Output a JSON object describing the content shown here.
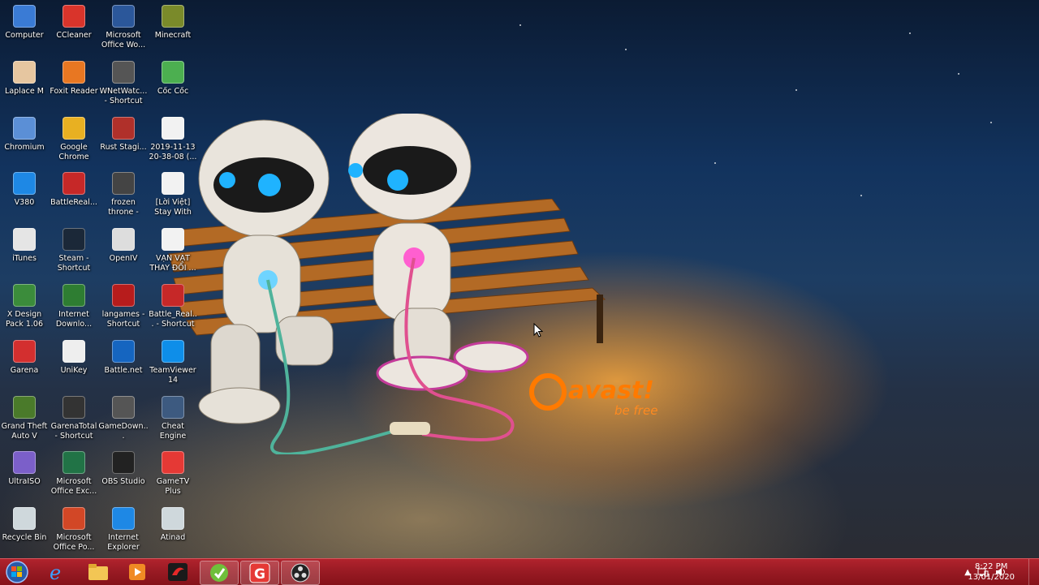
{
  "desktop_icons": [
    {
      "label": "Computer",
      "icon": "computer-icon",
      "color": "#3a7bd5"
    },
    {
      "label": "CCleaner",
      "icon": "ccleaner-icon",
      "color": "#d9342b"
    },
    {
      "label": "Microsoft Office Wo...",
      "icon": "word-icon",
      "color": "#2b579a"
    },
    {
      "label": "Minecraft",
      "icon": "minecraft-icon",
      "color": "#7a8a2a"
    },
    {
      "label": "Laplace M",
      "icon": "laplace-icon",
      "color": "#e6c6a0"
    },
    {
      "label": "Foxit Reader",
      "icon": "foxit-icon",
      "color": "#e87722"
    },
    {
      "label": "WNetWatc... - Shortcut",
      "icon": "wnetwatcher-icon",
      "color": "#555555"
    },
    {
      "label": "Cốc Cốc",
      "icon": "coccoc-icon",
      "color": "#4caf50"
    },
    {
      "label": "Chromium",
      "icon": "chromium-icon",
      "color": "#5b8fd6"
    },
    {
      "label": "Google Chrome",
      "icon": "chrome-icon",
      "color": "#e8b022"
    },
    {
      "label": "Rust Stagi...",
      "icon": "rust-icon",
      "color": "#b0302a"
    },
    {
      "label": "2019-11-13 20-38-08 (...",
      "icon": "audio-file-icon",
      "color": "#f2f2f2"
    },
    {
      "label": "V380",
      "icon": "v380-icon",
      "color": "#1e88e5"
    },
    {
      "label": "BattleReal...",
      "icon": "battlerealms-icon",
      "color": "#c62828"
    },
    {
      "label": "frozen throne - Shortcut",
      "icon": "frozen-throne-icon",
      "color": "#444444"
    },
    {
      "label": "[Lời Việt] Stay With Me - ...",
      "icon": "audio-file-icon",
      "color": "#f2f2f2"
    },
    {
      "label": "iTunes",
      "icon": "itunes-icon",
      "color": "#e5e5e5"
    },
    {
      "label": "Steam - Shortcut",
      "icon": "steam-icon",
      "color": "#1b2838"
    },
    {
      "label": "OpenIV",
      "icon": "openiv-icon",
      "color": "#dddddd"
    },
    {
      "label": "VẠN VẬT THAY ĐỔI ...",
      "icon": "audio-file-icon",
      "color": "#f2f2f2"
    },
    {
      "label": "X Design Pack 1.06",
      "icon": "xdesign-icon",
      "color": "#3b8c3b"
    },
    {
      "label": "Internet Downlo...",
      "icon": "idm-icon",
      "color": "#2e7d32"
    },
    {
      "label": "langames - Shortcut",
      "icon": "langames-icon",
      "color": "#b71c1c"
    },
    {
      "label": "Battle_Real... - Shortcut",
      "icon": "battlerealms-icon",
      "color": "#c62828"
    },
    {
      "label": "Garena",
      "icon": "garena-icon",
      "color": "#d32f2f"
    },
    {
      "label": "UniKey",
      "icon": "unikey-icon",
      "color": "#eeeeee"
    },
    {
      "label": "Battle.net",
      "icon": "battlenet-icon",
      "color": "#1565c0"
    },
    {
      "label": "TeamViewer 14",
      "icon": "teamviewer-icon",
      "color": "#0e8ee9"
    },
    {
      "label": "Grand Theft Auto V",
      "icon": "gta-icon",
      "color": "#4a7a2a"
    },
    {
      "label": "GarenaTotal - Shortcut",
      "icon": "garena-total-icon",
      "color": "#333333"
    },
    {
      "label": "GameDown...",
      "icon": "gamedown-icon",
      "color": "#555555"
    },
    {
      "label": "Cheat Engine",
      "icon": "cheat-engine-icon",
      "color": "#3d5a80"
    },
    {
      "label": "UltraISO",
      "icon": "ultraiso-icon",
      "color": "#7b5fc9"
    },
    {
      "label": "Microsoft Office Exc...",
      "icon": "excel-icon",
      "color": "#217346"
    },
    {
      "label": "OBS Studio",
      "icon": "obs-icon",
      "color": "#222222"
    },
    {
      "label": "GameTV Plus",
      "icon": "gametv-icon",
      "color": "#e53935"
    },
    {
      "label": "Recycle Bin",
      "icon": "recycle-bin-icon",
      "color": "#cfd8dc"
    },
    {
      "label": "Microsoft Office Po...",
      "icon": "powerpoint-icon",
      "color": "#d24726"
    },
    {
      "label": "Internet Explorer",
      "icon": "ie-icon",
      "color": "#1e88e5"
    },
    {
      "label": "Atinad",
      "icon": "atinad-icon",
      "color": "#cfd8dc"
    }
  ],
  "wallpaper": {
    "brand": "avast!",
    "tagline": "be free"
  },
  "taskbar": {
    "color": "#9a1b24",
    "pinned": [
      {
        "icon": "start-orb-icon"
      },
      {
        "icon": "internet-explorer-icon"
      },
      {
        "icon": "file-explorer-icon"
      },
      {
        "icon": "media-player-icon"
      },
      {
        "icon": "garena-icon"
      },
      {
        "icon": "coccoc-icon"
      },
      {
        "icon": "gametv-icon"
      },
      {
        "icon": "obs-icon"
      }
    ],
    "clock": {
      "time": "8:22 PM",
      "date": "13/01/2020"
    }
  }
}
